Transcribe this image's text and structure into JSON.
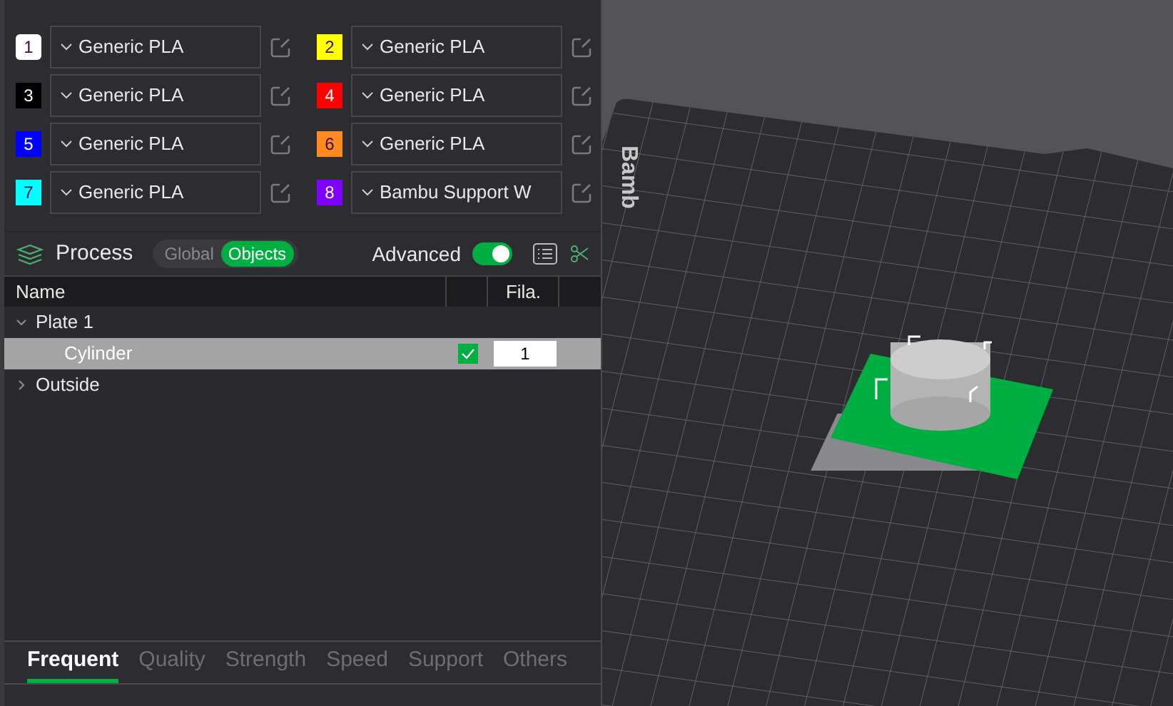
{
  "filaments": [
    {
      "number": "1",
      "color": "#ffffff",
      "material": "Generic PLA"
    },
    {
      "number": "2",
      "color": "#ffff00",
      "material": "Generic PLA"
    },
    {
      "number": "3",
      "color": "#000000",
      "material": "Generic PLA"
    },
    {
      "number": "4",
      "color": "#ff0000",
      "material": "Generic PLA"
    },
    {
      "number": "5",
      "color": "#0000ff",
      "material": "Generic PLA"
    },
    {
      "number": "6",
      "color": "#ff8a20",
      "material": "Generic PLA"
    },
    {
      "number": "7",
      "color": "#00ffff",
      "material": "Generic PLA"
    },
    {
      "number": "8",
      "color": "#8000ff",
      "material": "Bambu Support W"
    }
  ],
  "process": {
    "title": "Process",
    "modes": [
      {
        "label": "Global",
        "selected": false
      },
      {
        "label": "Objects",
        "selected": true
      }
    ],
    "advanced": {
      "label": "Advanced",
      "on": true
    }
  },
  "object_table": {
    "columns": [
      "Name",
      "Fila."
    ],
    "rows": [
      {
        "name": "Plate 1",
        "expanded": true,
        "selected": false,
        "children": [
          {
            "name": "Cylinder",
            "selected": true,
            "checked": true,
            "filament": "1"
          }
        ]
      },
      {
        "name": "Outside",
        "expanded": false,
        "selected": false
      }
    ]
  },
  "setting_tabs": [
    {
      "label": "Frequent",
      "selected": true
    },
    {
      "label": "Quality",
      "selected": false
    },
    {
      "label": "Strength",
      "selected": false
    },
    {
      "label": "Speed",
      "selected": false
    },
    {
      "label": "Support",
      "selected": false
    },
    {
      "label": "Others",
      "selected": false
    }
  ],
  "viewport": {
    "plate_logo": "Bamb"
  }
}
